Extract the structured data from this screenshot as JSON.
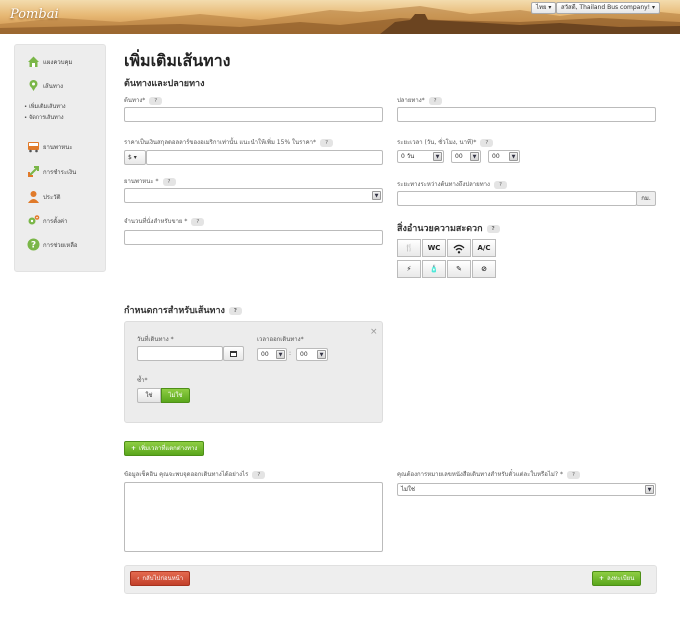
{
  "app": {
    "logo_text": "Pombai"
  },
  "topbar": {
    "language": "ไทย ▾",
    "account": "สวัสดี, Thailand Bus company! ▾"
  },
  "sidebar": {
    "items": [
      {
        "label": "แผงควบคุม",
        "icon": "home-icon"
      },
      {
        "label": "เส้นทาง",
        "icon": "map-pin-icon"
      },
      {
        "label": "ยานพาหนะ",
        "icon": "bus-icon"
      },
      {
        "label": "การชำระเงิน",
        "icon": "payment-arrows-icon"
      },
      {
        "label": "ประวัติ",
        "icon": "profile-icon"
      },
      {
        "label": "การตั้งค่า",
        "icon": "gears-icon"
      },
      {
        "label": "การช่วยเหลือ",
        "icon": "help-icon"
      }
    ],
    "subitems": [
      "เพิ่มเติมเส้นทาง",
      "จัดการเส้นทาง"
    ]
  },
  "page": {
    "title": "เพิ่มเติมเส้นทาง",
    "section_origin": "ต้นทางและปลายทาง",
    "section_schedule": "กำหนดการสำหรับเส้นทาง",
    "section_amenities": "สิ่งอำนวยความสะดวก"
  },
  "form": {
    "origin_label": "ต้นทาง*",
    "destination_label": "ปลายทาง*",
    "price_label": "ราคาเป็นเงินสกุลดอลลาร์ของอเมริกาเท่านั้น แนะนำให้เพิ่ม 15% ในราคา*",
    "currency": "$ ▾",
    "duration_label": "ระยะเวลา (วัน, ชั่วโมง, นาที)*",
    "duration_day": "0 วัน",
    "duration_hour": "00",
    "duration_min": "00",
    "vehicle_label": "ยานพาหนะ *",
    "distance_label": "ระยะทางระหว่างต้นทางถึงปลายทาง",
    "distance_unit": "กม.",
    "seats_label": "จำนวนที่นั่งสำหรับขาย *",
    "help": "?",
    "amenities": [
      "🍴",
      "WC",
      "wifi",
      "A/C",
      "⚡",
      "🧴",
      "✎",
      "⊘"
    ],
    "schedule": {
      "date_label": "วันที่เดินทาง *",
      "time_label": "เวลาออกเดินทาง*",
      "hour": "00",
      "minute": "00",
      "repeat_label": "ซ้ำ*",
      "yes": "ใช่",
      "no": "ไม่ใช่",
      "close": "×"
    },
    "add_time_button": "เพิ่มเวลาที่แตกต่างทาง",
    "checkin_label": "ข้อมูลเช็คอิน คุณจะพบจุดออกเดินทางได้อย่างไร",
    "ticket_label": "คุณต้องการหมายเลขหนังสือเดินทางสำหรับตั๋วแต่ละใบหรือไม่? *",
    "ticket_value": "ไม่ใช่",
    "back_button": "กลับไปก่อนหน้า",
    "submit_button": "ลงทะเบียน"
  }
}
